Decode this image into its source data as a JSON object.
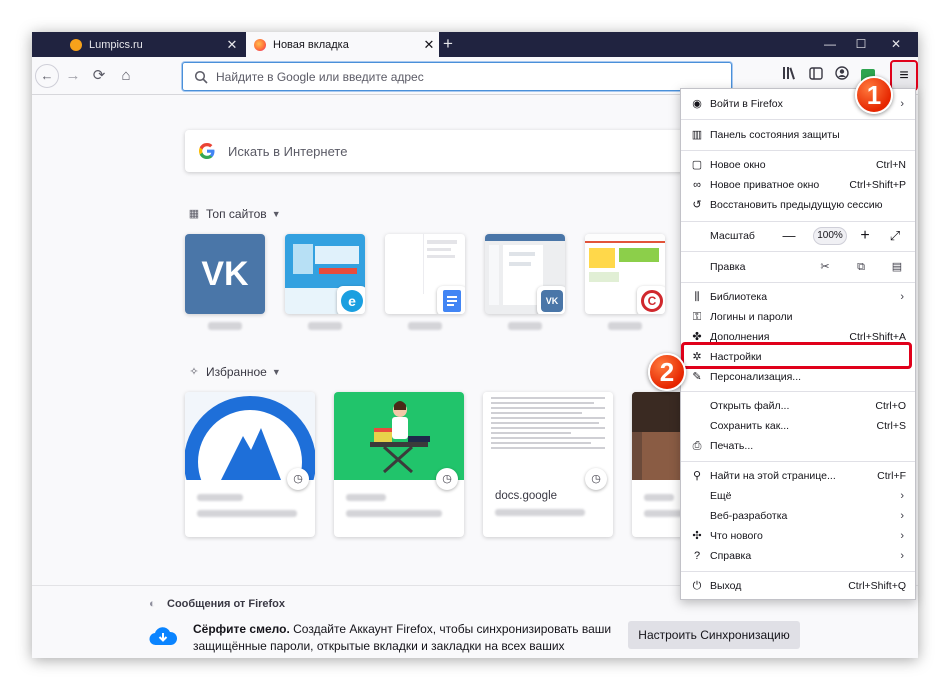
{
  "tabs": [
    {
      "title": "Lumpics.ru",
      "active": false,
      "favicon_color": "#f7a21b"
    },
    {
      "title": "Новая вкладка",
      "active": true,
      "favicon_color": "#ff7139"
    }
  ],
  "window_controls": {
    "minimize": "—",
    "maximize": "☐",
    "close": "✕"
  },
  "navbar": {
    "back": "←",
    "forward": "→",
    "reload": "⟳",
    "home": "⌂",
    "url_placeholder": "Найдите в Google или введите адрес",
    "menu_button": "≡"
  },
  "newtab": {
    "search_placeholder": "Искать в Интернете",
    "top_sites_title": "Топ сайтов",
    "highlights_title": "Избранное",
    "highlight_cards": [
      {
        "source": ""
      },
      {
        "source": ""
      },
      {
        "source": "docs.google"
      },
      {
        "source": ""
      }
    ]
  },
  "footer": {
    "messages_title": "Сообщения от Firefox",
    "message_bold": "Сёрфите смело.",
    "message_text": " Создайте Аккаунт Firefox, чтобы синхронизировать ваши защищённые пароли, открытые вкладки и закладки на всех ваших устройствах.",
    "sync_button": "Настроить Синхронизацию"
  },
  "app_menu": {
    "signin": "Войти в Firefox",
    "protection": "Панель состояния защиты",
    "new_window": {
      "label": "Новое окно",
      "key": "Ctrl+N"
    },
    "private_window": {
      "label": "Новое приватное окно",
      "key": "Ctrl+Shift+P"
    },
    "restore_session": "Восстановить предыдущую сессию",
    "zoom": {
      "label": "Масштаб",
      "minus": "—",
      "value": "100%",
      "plus": "+",
      "fullscreen": "⤢"
    },
    "edit": {
      "label": "Правка"
    },
    "library": "Библиотека",
    "logins": "Логины и пароли",
    "addons": {
      "label": "Дополнения",
      "key": "Ctrl+Shift+A"
    },
    "settings": "Настройки",
    "customize": "Персонализация...",
    "open_file": {
      "label": "Открыть файл...",
      "key": "Ctrl+O"
    },
    "save_as": {
      "label": "Сохранить как...",
      "key": "Ctrl+S"
    },
    "print": "Печать...",
    "find": {
      "label": "Найти на этой странице...",
      "key": "Ctrl+F"
    },
    "more": "Ещё",
    "web_dev": "Веб-разработка",
    "whats_new": "Что нового",
    "help": "Справка",
    "exit": {
      "label": "Выход",
      "key": "Ctrl+Shift+Q"
    }
  },
  "annotations": {
    "step1": "1",
    "step2": "2",
    "accent_color": "#e0001a"
  }
}
